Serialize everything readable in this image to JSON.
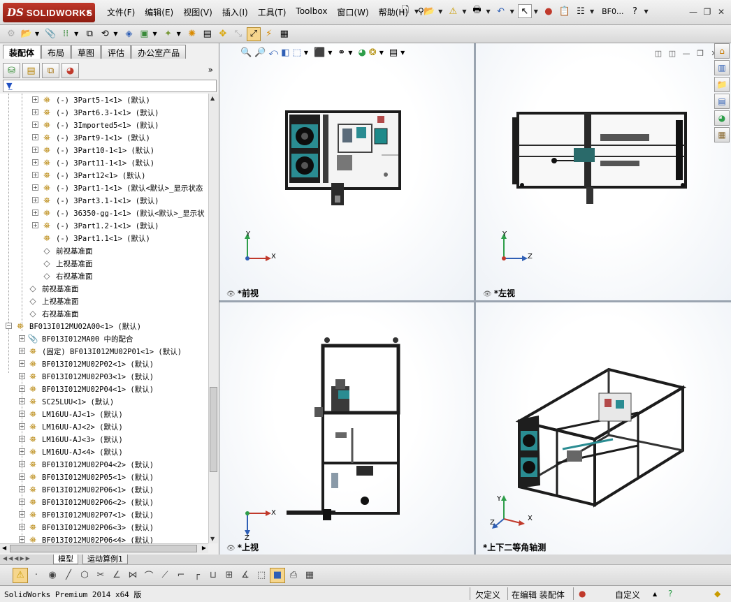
{
  "app": {
    "logo_mark": "DS",
    "logo_text": "SOLIDWORKS",
    "doc_name": "BF0...",
    "help": "?"
  },
  "menu": [
    "文件(F)",
    "编辑(E)",
    "视图(V)",
    "插入(I)",
    "工具(T)",
    "Toolbox",
    "窗口(W)",
    "帮助(H)"
  ],
  "tabs": [
    "装配体",
    "布局",
    "草图",
    "评估",
    "办公室产品"
  ],
  "active_tab": "装配体",
  "tree": {
    "sub_items": [
      {
        "label": "(-) 3Part5-1<1> (默认)"
      },
      {
        "label": "(-) 3Part6.3-1<1> (默认)"
      },
      {
        "label": "(-) 3Imported5<1> (默认)"
      },
      {
        "label": "(-) 3Part9-1<1> (默认)"
      },
      {
        "label": "(-) 3Part10-1<1> (默认)"
      },
      {
        "label": "(-) 3Part11-1<1> (默认)"
      },
      {
        "label": "(-) 3Part12<1> (默认)"
      },
      {
        "label": "(-) 3Part1-1<1> (默认<默认>_显示状态"
      },
      {
        "label": "(-) 3Part3.1-1<1> (默认)"
      },
      {
        "label": "(-) 36350-gg-1<1> (默认<默认>_显示状"
      },
      {
        "label": "(-) 3Part1.2-1<1> (默认)"
      },
      {
        "label": "(-) 3Part1.1<1> (默认)"
      }
    ],
    "sub_planes": [
      "前视基准面",
      "上视基准面",
      "右视基准面"
    ],
    "planes": [
      "前视基准面",
      "上视基准面",
      "右视基准面"
    ],
    "assembly": "BF013I012MU02A00<1> (默认)",
    "mates": "BF013I012MA00 中的配合",
    "components": [
      "(固定) BF013I012MU02P01<1> (默认)",
      "BF013I012MU02P02<1> (默认)",
      "BF013I012MU02P03<1> (默认)",
      "BF013I012MU02P04<1> (默认)",
      "SC25LUU<1> (默认)",
      "LM16UU-AJ<1> (默认)",
      "LM16UU-AJ<2> (默认)",
      "LM16UU-AJ<3> (默认)",
      "LM16UU-AJ<4> (默认)",
      "BF013I012MU02P04<2> (默认)",
      "BF013I012MU02P05<1> (默认)",
      "BF013I012MU02P06<1> (默认)",
      "BF013I012MU02P06<2> (默认)",
      "BF013I012MU02P07<1> (默认)",
      "BF013I012MU02P06<3> (默认)",
      "BF013I012MU02P06<4> (默认)"
    ]
  },
  "views": {
    "front": "*前视",
    "left": "*左视",
    "top": "*上视",
    "iso": "*上下二等角轴测"
  },
  "axes": {
    "x": "X",
    "y": "Y",
    "z": "Z"
  },
  "bottom_tabs": [
    "模型",
    "运动算例1"
  ],
  "status": {
    "version": "SolidWorks Premium 2014 x64 版",
    "defined": "欠定义",
    "editing": "在编辑 装配体",
    "custom": "自定义"
  }
}
